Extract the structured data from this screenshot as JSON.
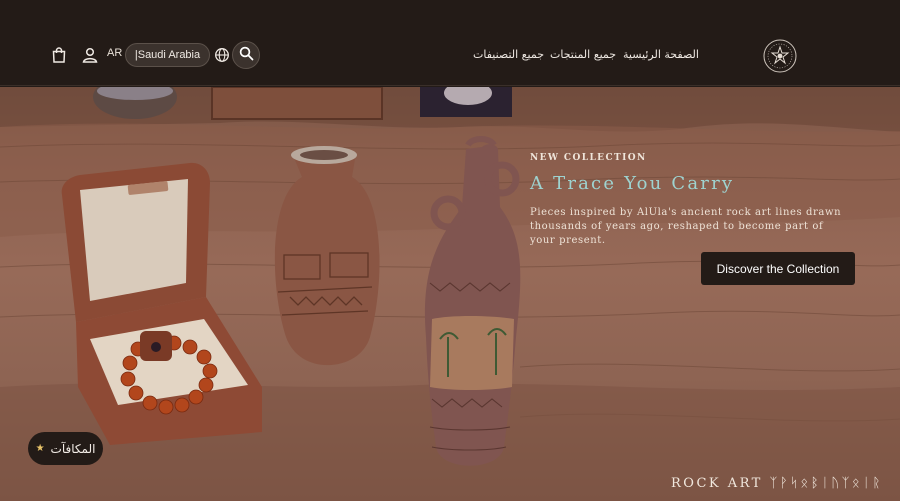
{
  "header": {
    "language": "AR",
    "region": "|Saudi Arabia",
    "nav": {
      "home": "الصفحة الرئيسية",
      "all_products": "جميع المنتجات",
      "all_categories": "جميع التصنيفات"
    },
    "icons": [
      "cart-icon",
      "user-icon",
      "globe-icon",
      "search-icon",
      "logo-emblem"
    ]
  },
  "hero": {
    "eyebrow": "NEW COLLECTION",
    "title": "A Trace You Carry",
    "description": "Pieces inspired by AlUla's ancient rock art lines drawn thousands of years ago, reshaped to become part of your present.",
    "cta_label": "Discover the Collection",
    "wordmark": "ROCK ART ᛉᚹᛋᛟᛒᛁᚢᛉᛟᛁᚱ",
    "colors": {
      "title": "#9ed3d0",
      "cta_bg": "#231b17",
      "header_bg": "#231b17"
    }
  },
  "rewards": {
    "label": "المكافآت",
    "icon": "star-icon"
  }
}
